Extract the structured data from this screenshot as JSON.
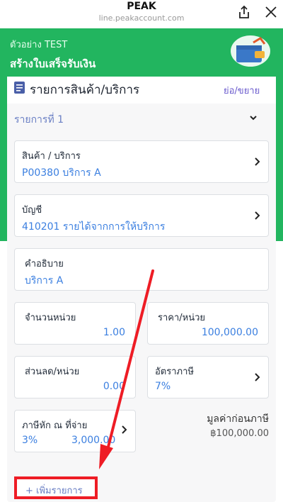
{
  "browser": {
    "title": "PEAK",
    "url": "line.peakaccount.com",
    "share_icon": "share-icon",
    "close_icon": "close-icon"
  },
  "header": {
    "company": "ตัวอย่าง TEST",
    "page_title": "สร้างใบเสร็จรับเงิน",
    "wallet_icon": "wallet-icon"
  },
  "section": {
    "title": "รายการสินค้า/บริการ",
    "toggle_label": "ย่อ/ขยาย"
  },
  "item": {
    "label": "รายการที่ 1",
    "product": {
      "label": "สินค้า / บริการ",
      "value": "P00380 บริการ A"
    },
    "account": {
      "label": "บัญชี",
      "value": "410201 รายได้จากการให้บริการ"
    },
    "description": {
      "label": "คำอธิบาย",
      "value": "บริการ A"
    },
    "quantity": {
      "label": "จำนวนหน่วย",
      "value": "1.00"
    },
    "unit_price": {
      "label": "ราคา/หน่วย",
      "value": "100,000.00"
    },
    "discount": {
      "label": "ส่วนลด/หน่วย",
      "value": "0.00"
    },
    "tax_rate": {
      "label": "อัตราภาษี",
      "value": "7%"
    },
    "withholding": {
      "label": "ภาษีหัก ณ ที่จ่าย",
      "rate": "3%",
      "amount": "3,000.00"
    },
    "pre_tax": {
      "label": "มูลค่าก่อนภาษี",
      "value": "฿100,000.00"
    }
  },
  "add_item_label": "+ เพิ่มรายการ",
  "colors": {
    "brand_green": "#22b55f",
    "link_blue": "#3b7fe0",
    "highlight_red": "#ee1c25"
  }
}
